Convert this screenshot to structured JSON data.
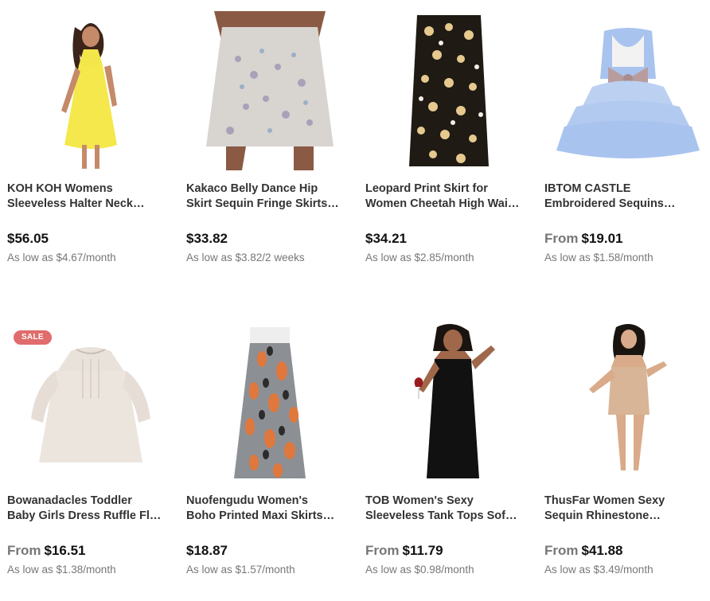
{
  "products": [
    {
      "title_line1": "KOH KOH Womens",
      "title_line2": "Sleeveless Halter Neck…",
      "from_label": "",
      "price": "$56.05",
      "monthly": "As low as $4.67/month",
      "badge": "",
      "image_icon": "yellow-dress-image"
    },
    {
      "title_line1": "Kakaco Belly Dance Hip",
      "title_line2": "Skirt Sequin Fringe Skirts…",
      "from_label": "",
      "price": "$33.82",
      "monthly": "As low as $3.82/2 weeks",
      "badge": "",
      "image_icon": "sequin-fringe-skirt-image"
    },
    {
      "title_line1": "Leopard Print Skirt for",
      "title_line2": "Women Cheetah High Wai…",
      "from_label": "",
      "price": "$34.21",
      "monthly": "As low as $2.85/month",
      "badge": "",
      "image_icon": "floral-midi-skirt-image"
    },
    {
      "title_line1": "IBTOM CASTLE",
      "title_line2": "Embroidered Sequins…",
      "from_label": "From",
      "price": "$19.01",
      "monthly": "As low as $1.58/month",
      "badge": "",
      "image_icon": "blue-tutu-dress-image"
    },
    {
      "title_line1": "Bowanadacles Toddler",
      "title_line2": "Baby Girls Dress Ruffle Fl…",
      "from_label": "From",
      "price": "$16.51",
      "monthly": "As low as $1.38/month",
      "badge": "SALE",
      "image_icon": "toddler-dress-image"
    },
    {
      "title_line1": "Nuofengudu Women's",
      "title_line2": "Boho Printed Maxi Skirts…",
      "from_label": "",
      "price": "$18.87",
      "monthly": "As low as $1.57/month",
      "badge": "",
      "image_icon": "maxi-skirt-image"
    },
    {
      "title_line1": "TOB Women's Sexy",
      "title_line2": "Sleeveless Tank Tops Sof…",
      "from_label": "From",
      "price": "$11.79",
      "monthly": "As low as $0.98/month",
      "badge": "",
      "image_icon": "black-tank-dress-image"
    },
    {
      "title_line1": "ThusFar Women Sexy",
      "title_line2": "Sequin Rhinestone…",
      "from_label": "From",
      "price": "$41.88",
      "monthly": "As low as $3.49/month",
      "badge": "",
      "image_icon": "beige-bodycon-dress-image"
    }
  ],
  "colors": {
    "sale_badge": "#e06c6c",
    "price": "#111111",
    "muted": "#777777",
    "title": "#333333"
  }
}
